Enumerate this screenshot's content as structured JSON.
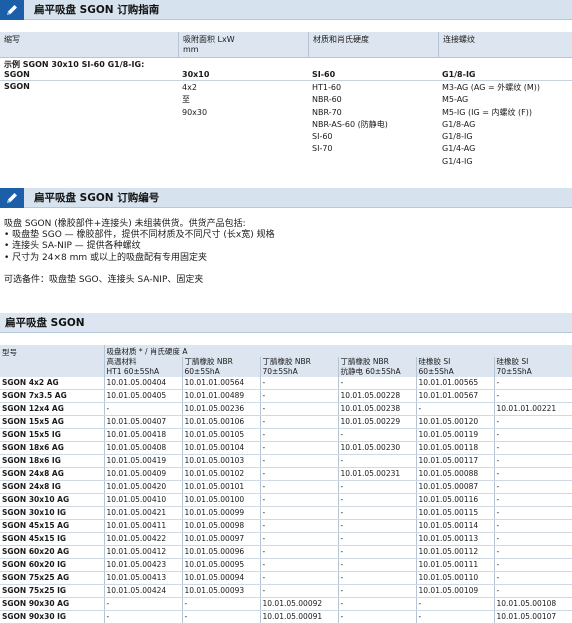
{
  "colors": {
    "banner_bg": "#d6e3ef",
    "icon_bg": "#1c5fa8",
    "header_bg": "#dde6f0"
  },
  "section1": {
    "icon": "pencil-icon",
    "title": "扁平吸盘 SGON 订购指南",
    "headers": [
      "缩写",
      "吸附面积 LxW\nmm",
      "材质和肖氏硬度",
      "连接螺纹"
    ],
    "example_label": "示例 SGON 30x10 SI-60 G1/8-IG:",
    "example_values": [
      "SGON",
      "30x10",
      "SI-60",
      "G1/8-IG"
    ],
    "options": {
      "abbr": "SGON",
      "sizes": [
        "4x2",
        "至",
        "90x30"
      ],
      "materials": [
        "HT1-60",
        "NBR-60",
        "NBR-70",
        "NBR-AS-60 (防静电)",
        "SI-60",
        "SI-70"
      ],
      "threads": [
        "M3-AG (AG = 外螺纹 (M))",
        "M5-AG",
        "M5-IG (IG = 内螺纹 (F))",
        "G1/8-AG",
        "G1/8-IG",
        "G1/4-AG",
        "G1/4-IG"
      ]
    }
  },
  "section2": {
    "icon": "pencil-icon",
    "title": "扁平吸盘 SGON 订购编号",
    "intro": "吸盘 SGON (橡胶部件+连接头) 未组装供货。供货产品包括:",
    "bullets": [
      "吸盘垫 SGO — 橡胶部件，提供不同材质及不同尺寸 (长x宽) 规格",
      "连接头 SA-NIP — 提供各种螺纹",
      "尺寸为 24×8 mm 或以上的吸盘配有专用固定夹"
    ],
    "optional": "可选备件：吸盘垫 SGO、连接头 SA-NIP、固定夹"
  },
  "section3": {
    "title": "扁平吸盘 SGON",
    "table": {
      "col_type": "型号",
      "group_header": "吸盘材质 * / 肖氏硬度 A",
      "columns": [
        [
          "高温材料",
          "HT1 60±5ShA"
        ],
        [
          "丁腈橡胶 NBR",
          "60±5ShA"
        ],
        [
          "丁腈橡胶 NBR",
          "70±5ShA"
        ],
        [
          "丁腈橡胶 NBR",
          "抗静电 60±5ShA"
        ],
        [
          "硅橡胶 SI",
          "60±5ShA"
        ],
        [
          "硅橡胶 SI",
          "70±5ShA"
        ]
      ],
      "rows": [
        [
          "SGON 4x2 AG",
          "10.01.05.00404",
          "10.01.01.00564",
          "-",
          "-",
          "10.01.01.00565",
          "-"
        ],
        [
          "SGON 7x3.5 AG",
          "10.01.05.00405",
          "10.01.01.00489",
          "-",
          "10.01.05.00228",
          "10.01.01.00567",
          "-"
        ],
        [
          "SGON 12x4 AG",
          "-",
          "10.01.05.00236",
          "-",
          "10.01.05.00238",
          "-",
          "10.01.01.00221"
        ],
        [
          "SGON 15x5 AG",
          "10.01.05.00407",
          "10.01.05.00106",
          "-",
          "10.01.05.00229",
          "10.01.05.00120",
          "-"
        ],
        [
          "SGON 15x5 IG",
          "10.01.05.00418",
          "10.01.05.00105",
          "-",
          "-",
          "10.01.05.00119",
          "-"
        ],
        [
          "SGON 18x6 AG",
          "10.01.05.00408",
          "10.01.05.00104",
          "-",
          "10.01.05.00230",
          "10.01.05.00118",
          "-"
        ],
        [
          "SGON 18x6 IG",
          "10.01.05.00419",
          "10.01.05.00103",
          "-",
          "-",
          "10.01.05.00117",
          "-"
        ],
        [
          "SGON 24x8 AG",
          "10.01.05.00409",
          "10.01.05.00102",
          "-",
          "10.01.05.00231",
          "10.01.05.00088",
          "-"
        ],
        [
          "SGON 24x8 IG",
          "10.01.05.00420",
          "10.01.05.00101",
          "-",
          "-",
          "10.01.05.00087",
          "-"
        ],
        [
          "SGON 30x10 AG",
          "10.01.05.00410",
          "10.01.05.00100",
          "-",
          "-",
          "10.01.05.00116",
          "-"
        ],
        [
          "SGON 30x10 IG",
          "10.01.05.00421",
          "10.01.05.00099",
          "-",
          "-",
          "10.01.05.00115",
          "-"
        ],
        [
          "SGON 45x15 AG",
          "10.01.05.00411",
          "10.01.05.00098",
          "-",
          "-",
          "10.01.05.00114",
          "-"
        ],
        [
          "SGON 45x15 IG",
          "10.01.05.00422",
          "10.01.05.00097",
          "-",
          "-",
          "10.01.05.00113",
          "-"
        ],
        [
          "SGON 60x20 AG",
          "10.01.05.00412",
          "10.01.05.00096",
          "-",
          "-",
          "10.01.05.00112",
          "-"
        ],
        [
          "SGON 60x20 IG",
          "10.01.05.00423",
          "10.01.05.00095",
          "-",
          "-",
          "10.01.05.00111",
          "-"
        ],
        [
          "SGON 75x25 AG",
          "10.01.05.00413",
          "10.01.05.00094",
          "-",
          "-",
          "10.01.05.00110",
          "-"
        ],
        [
          "SGON 75x25 IG",
          "10.01.05.00424",
          "10.01.05.00093",
          "-",
          "-",
          "10.01.05.00109",
          "-"
        ],
        [
          "SGON 90x30 AG",
          "-",
          "-",
          "10.01.05.00092",
          "-",
          "-",
          "10.01.05.00108"
        ],
        [
          "SGON 90x30 IG",
          "-",
          "-",
          "10.01.05.00091",
          "-",
          "-",
          "10.01.05.00107"
        ]
      ]
    }
  }
}
